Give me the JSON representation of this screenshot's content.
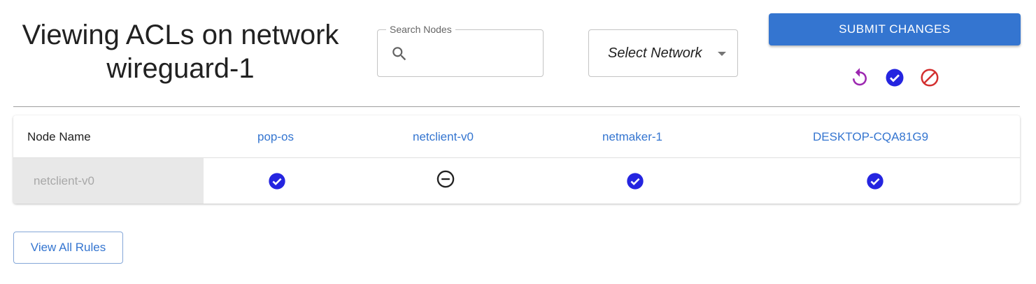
{
  "header": {
    "title": "Viewing ACLs on network wireguard-1"
  },
  "search": {
    "label": "Search Nodes",
    "value": "",
    "placeholder": ""
  },
  "network_select": {
    "value": "Select Network"
  },
  "toolbar": {
    "submit_label": "SUBMIT CHANGES",
    "icons": [
      "reset-icon",
      "allow-all-icon",
      "deny-all-icon"
    ]
  },
  "table": {
    "corner_header": "Node Name",
    "columns": [
      "pop-os",
      "netclient-v0",
      "netmaker-1",
      "DESKTOP-CQA81G9"
    ],
    "rows": [
      {
        "node": "netclient-v0",
        "cells": [
          "allowed",
          "self",
          "allowed",
          "allowed"
        ]
      }
    ]
  },
  "footer": {
    "view_all_label": "View All Rules"
  },
  "colors": {
    "accent": "#3475d0",
    "allowed": "#2525e0",
    "reset": "#9c27b0",
    "deny": "#d32f2f",
    "self": "#212121"
  }
}
